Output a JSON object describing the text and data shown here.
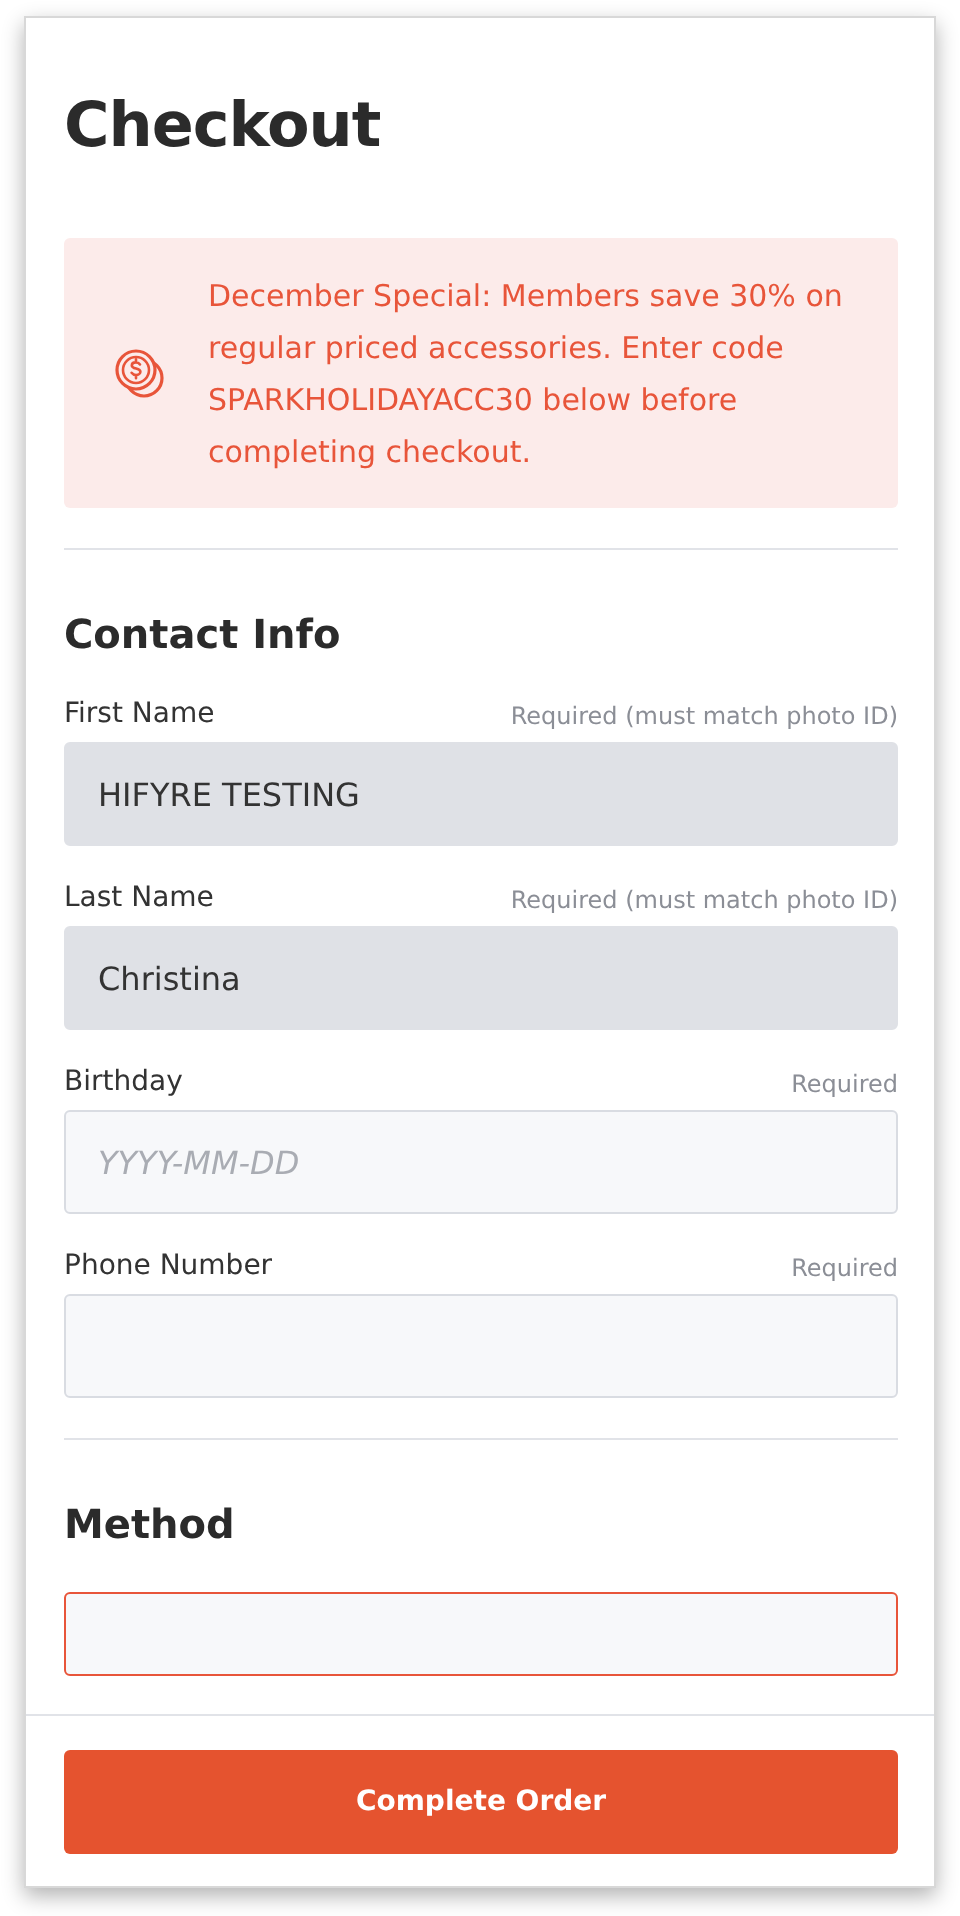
{
  "title": "Checkout",
  "banner": {
    "text": "December Special: Members save 30% on regular priced accessories. Enter code SPARKHOLIDAYACC30 below before completing checkout."
  },
  "contact": {
    "title": "Contact Info",
    "fields": [
      {
        "label": "First Name",
        "note": "Required (must match photo ID)",
        "value": "HIFYRE TESTING",
        "disabled": true
      },
      {
        "label": "Last Name",
        "note": "Required (must match photo ID)",
        "value": "Christina",
        "disabled": true
      },
      {
        "label": "Birthday",
        "note": "Required",
        "placeholder": "YYYY-MM-DD",
        "disabled": false
      },
      {
        "label": "Phone Number",
        "note": "Required",
        "disabled": false
      }
    ]
  },
  "method": {
    "title": "Method",
    "options": [
      {
        "selected": true
      }
    ]
  },
  "footer": {
    "button": "Complete Order"
  }
}
